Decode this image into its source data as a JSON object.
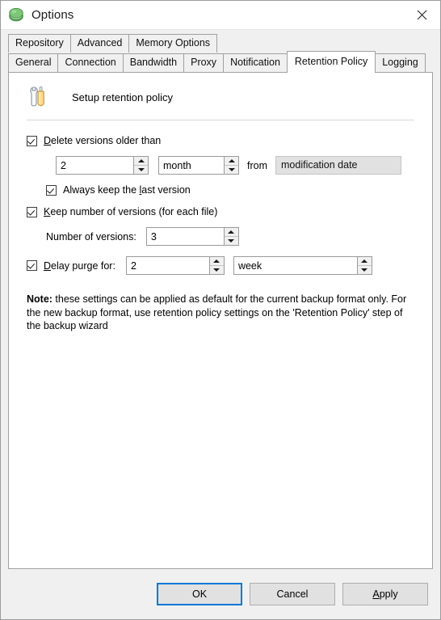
{
  "window": {
    "title": "Options",
    "icon": "app-green-blob-icon",
    "close_label": "✕"
  },
  "tabs": {
    "row1": [
      {
        "label": "Repository",
        "active": false
      },
      {
        "label": "Advanced",
        "active": false
      },
      {
        "label": "Memory Options",
        "active": false
      }
    ],
    "row2": [
      {
        "label": "General",
        "active": false
      },
      {
        "label": "Connection",
        "active": false
      },
      {
        "label": "Bandwidth",
        "active": false
      },
      {
        "label": "Proxy",
        "active": false
      },
      {
        "label": "Notification",
        "active": false
      },
      {
        "label": "Retention Policy",
        "active": true
      },
      {
        "label": "Logging",
        "active": false
      }
    ]
  },
  "panel": {
    "icon": "tools-wrench-screwdriver-icon",
    "title": "Setup retention policy"
  },
  "form": {
    "delete_versions": {
      "checked": true,
      "accel": "D",
      "label_rest": "elete versions older than",
      "amount": "2",
      "unit": "month",
      "from_label": "from",
      "from_value": "modification date",
      "from_disabled": true
    },
    "always_keep_last": {
      "checked": true,
      "label_pre": "Always keep the ",
      "accel": "l",
      "label_rest": "ast version"
    },
    "keep_number": {
      "checked": true,
      "accel": "K",
      "label_rest": "eep number of versions (for each file)",
      "field_label": "Number of versions:",
      "value": "3"
    },
    "delay_purge": {
      "checked": true,
      "accel": "D",
      "label_rest": "elay purge for:",
      "amount": "2",
      "unit": "week"
    },
    "note": {
      "bold": "Note:",
      "text": "  these settings can be applied as default for the current backup format only. For the new backup format, use retention policy settings on the 'Retention Policy' step of the backup wizard"
    }
  },
  "footer": {
    "ok": "OK",
    "cancel": "Cancel",
    "apply_accel": "A",
    "apply_rest": "pply"
  },
  "colors": {
    "accent": "#0078d7",
    "window_bg": "#f0f0f0",
    "panel_bg": "#ffffff",
    "border": "#a0a0a0",
    "disabled_bg": "#e1e1e1"
  }
}
